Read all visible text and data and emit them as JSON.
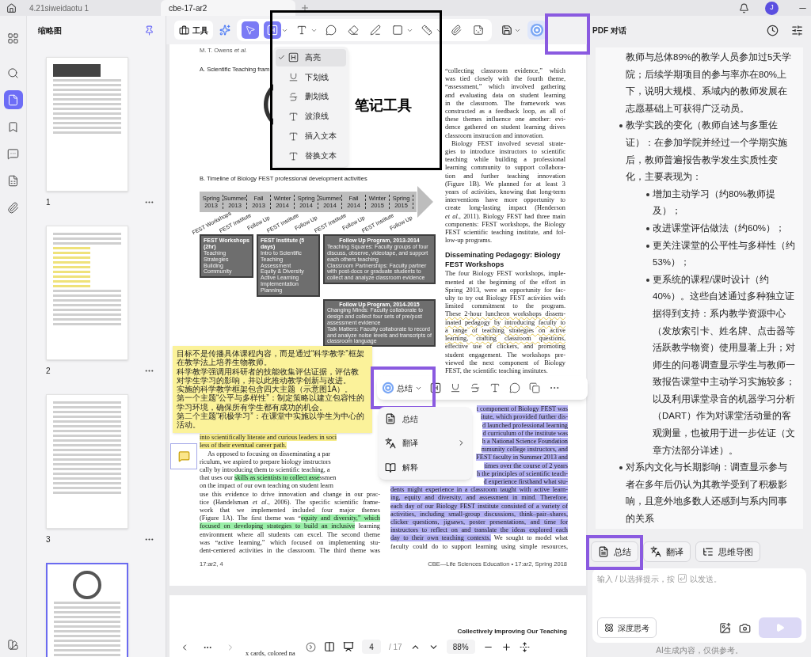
{
  "tabs": [
    {
      "label": "4.21siweidaotu 1",
      "selected": false
    },
    {
      "label": "cbe-17-ar2",
      "selected": true
    }
  ],
  "user": {
    "avatar": "J"
  },
  "rail": [
    {
      "kind": "grid",
      "selected": false
    },
    {
      "kind": "search",
      "selected": false
    },
    {
      "kind": "pages",
      "selected": true
    },
    {
      "kind": "bookmarks",
      "selected": false
    },
    {
      "kind": "comments",
      "selected": false
    },
    {
      "kind": "forms",
      "selected": false
    },
    {
      "kind": "attachments",
      "selected": false
    }
  ],
  "thumbnails": {
    "title": "缩略图",
    "pages": [
      {
        "number": "1",
        "selected": false,
        "kind": "title"
      },
      {
        "number": "2",
        "selected": false,
        "kind": "highlighted"
      },
      {
        "number": "3",
        "selected": false,
        "kind": "text"
      },
      {
        "selected": true,
        "kind": "figure"
      }
    ]
  },
  "toolbar": {
    "tools_label": "工具",
    "tools": [
      {
        "kind": "select",
        "selected": true,
        "menu": false
      },
      {
        "kind": "highlight",
        "selected": true,
        "menu": true
      },
      {
        "kind": "text",
        "selected": false,
        "menu": true
      },
      {
        "kind": "comment",
        "selected": false,
        "menu": false
      },
      {
        "kind": "eraser",
        "selected": false,
        "menu": false
      },
      {
        "kind": "pen",
        "selected": false,
        "menu": false
      },
      {
        "kind": "shape",
        "selected": false,
        "menu": true
      },
      {
        "kind": "ruler",
        "selected": false,
        "menu": true
      },
      {
        "kind": "attachment",
        "selected": false,
        "menu": false
      },
      {
        "kind": "sticker",
        "selected": false,
        "menu": false
      }
    ],
    "ai_selected": true
  },
  "note_tools_menu": [
    {
      "kind": "highlight",
      "label": "高亮",
      "checked": true
    },
    {
      "kind": "underline",
      "label": "下划线",
      "checked": false
    },
    {
      "kind": "strikethrough",
      "label": "删划线",
      "checked": false
    },
    {
      "kind": "squiggly",
      "label": "波浪线",
      "checked": false
    },
    {
      "kind": "insert",
      "label": "插入文本",
      "checked": false
    },
    {
      "kind": "replace",
      "label": "替换文本",
      "checked": false
    }
  ],
  "callout": {
    "label": "笔记工具"
  },
  "document": {
    "header": "M. T. Owens *et al.*",
    "figure_a_caption": "A. Scientific Teaching fram",
    "timeline": {
      "title": "B. Timeline of Biology FEST professional development activities",
      "seasons": [
        "Spring 2013",
        "Summer 2013",
        "Fall 2013",
        "Winter 2014",
        "Spring 2014",
        "Summer 2014",
        "Fall 2014",
        "Winter 2015",
        "Spring 2015"
      ],
      "labels": [
        "FEST Workshops",
        "FEST Institute",
        "Follow Up",
        "FEST Institute",
        "Follow Up",
        "FEST Institute",
        "Follow Up",
        "FEST Institute",
        "Follow Up"
      ]
    },
    "boxes": [
      {
        "title": "FEST Workshops (2hr)",
        "lines": [
          "Teaching Strategies",
          "Building Community"
        ]
      },
      {
        "title": "FEST Institute (5 days)",
        "lines": [
          "Intro to Scientific Teaching",
          "Assessment",
          "Equity & Diversity",
          "Active Learning",
          "Implementation Planning"
        ]
      },
      {
        "title": "Follow Up Program, 2013-2014",
        "lines": [
          "Teaching Squares: Faculty groups of four discuss, observe, videotape, and support each others teaching",
          "Classroom Partnerships: Faculty partner with post-docs or graduate students to collect and analyze classroom evidence"
        ]
      },
      {
        "title": "Follow Up Program, 2014-2015",
        "lines": [
          "Changing Minds: Faculty collaborate to design and collect four sets of pre/post assessment evidence",
          "Talk Matters: Faculty collaborate to record and analyze noise levels and transcripts of classroom language"
        ]
      }
    ],
    "top_right_lines": [
      {
        "text": "“collecting classroom evidence,” which"
      },
      {
        "text": "was tied closely with the fourth theme,"
      },
      {
        "text": "“assessment,” which involved gathering"
      },
      {
        "text": "and evaluating data on student learning"
      },
      {
        "text": "in the classroom. The framework was"
      },
      {
        "text": "constructed as a feedback loop, as all of"
      },
      {
        "text": "these themes influence one another: evi-"
      },
      {
        "text": "dence gathered on student learning drives"
      },
      {
        "text": "classroom instruction and innovation.",
        "kind": "last"
      },
      {
        "text": "Biology FEST involved several strate-",
        "kind": "indent"
      },
      {
        "text": "gies to introduce instructors to scientific"
      },
      {
        "text": "teaching while building a professional"
      },
      {
        "text": "learning community to support collabora-"
      },
      {
        "text": "tion and further teaching innovation"
      },
      {
        "text": "(Figure 1B). We planned for at least 3"
      },
      {
        "text": "years of activities, knowing that long-term"
      },
      {
        "text": "interventions have more opportunity to"
      },
      {
        "text": "create long-lasting impact (Henderson"
      },
      {
        "text": "*et al.*, 2011). Biology FEST had three main"
      },
      {
        "text": "components: FEST workshops, the Biology"
      },
      {
        "text": "FEST scientific teaching institute, and fol-"
      },
      {
        "text": "low-up programs.",
        "kind": "last"
      },
      {
        "text": "Disseminating Pedagogy: Biology FEST Workshops",
        "kind": "heading"
      },
      {
        "text": "The four Biology FEST workshops, imple-"
      },
      {
        "text": "mented at the beginning of the effort in"
      },
      {
        "text": "Spring 2013, were an opportunity for fac-"
      },
      {
        "text": "ulty to try out Biology FEST activities with"
      },
      {
        "text": "limited commitment to the program."
      },
      {
        "text": "These 2-hour luncheon workshops dissem-",
        "kind": "squiggly"
      },
      {
        "text": "inated pedagogy by introducing faculty to",
        "kind": "squiggly"
      },
      {
        "text": "a range of teaching strategies on active",
        "kind": "squiggly"
      },
      {
        "text": "learning, crafting classroom questions,",
        "kind": "squiggly"
      },
      {
        "text": "effective use of clickers, and promoting"
      },
      {
        "text": "student engagement. The workshops pre-"
      },
      {
        "text": "viewed the next component of Biology"
      },
      {
        "text": "FEST, the scientific teaching institutes.",
        "kind": "last"
      }
    ],
    "left_lines": [
      {
        "text": "into scientifically literate and curious leaders in soci",
        "color": "#f6ec8a",
        "kind": "last"
      },
      {
        "text": "less of their eventual career path.",
        "color": "#f6ec8a",
        "kind": "last"
      },
      {
        "text": "As opposed to focusing on disseminating a par",
        "kind": "indent_cut"
      },
      {
        "text": "riculum, we aspired to prepare biology instructors",
        "kind": "last"
      },
      {
        "text": "cally by introducing them to scientific teaching, a",
        "kind": "last"
      },
      {
        "parts": [
          {
            "text": "that uses our "
          },
          {
            "text": "skills as scientists to collect asse",
            "color": "#9af0a8"
          },
          {
            "text": "ssmen"
          }
        ],
        "kind": "last"
      },
      {
        "text": "on the impact of our own teaching on student learn",
        "kind": "last"
      },
      {
        "text": "use this evidence to drive innovation and change in our prac-"
      },
      {
        "text": "tice (Handelsman *et al.*, 2006). The specific scientific frame-"
      },
      {
        "text": "work that we implemented included four major themes"
      },
      {
        "parts": [
          {
            "text": "(Figure 1A). The first theme was “"
          },
          {
            "text": "equity and diversity,” which",
            "color": "#9af0a8"
          }
        ]
      },
      {
        "parts": [
          {
            "text": "focused on developing strategies to build an inclusive",
            "color": "#9af0a8"
          },
          {
            "text": " learning"
          }
        ]
      },
      {
        "text": "environment where all students can excel. The second theme"
      },
      {
        "text": "was “active learning,” which focused on implementing stu-"
      },
      {
        "text": "dent-centered activities in the classroom. The third theme was"
      }
    ],
    "right_lines": [
      {
        "text": "t component of Biology FEST was",
        "color": "#b3b0f3",
        "kind": "cut"
      },
      {
        "text": "itute, which provided further dis-",
        "color": "#b3b0f3",
        "kind": "cut"
      },
      {
        "text": "d launched professional learning",
        "color": "#b3b0f3",
        "kind": "cut"
      },
      {
        "text": "d curriculum of the institute was",
        "color": "#b3b0f3",
        "kind": "cut"
      },
      {
        "text": "h a National Science Foundation",
        "color": "#b3b0f3",
        "kind": "cut"
      },
      {
        "text": "mmunity college instructors, and",
        "color": "#b3b0f3",
        "kind": "cut"
      },
      {
        "text": "FEST faculty in Summer 2013 and",
        "color": "#b3b0f3",
        "kind": "cut"
      },
      {
        "text": "times over the course of 2 years",
        "color": "#b3b0f3",
        "kind": "cut"
      },
      {
        "text": "h the principles of scientific teach-",
        "color": "#b3b0f3",
        "kind": "cut"
      },
      {
        "text": "d experience firsthand what stu-",
        "color": "#b3b0f3",
        "kind": "cut"
      },
      {
        "text": "dents might experience in a classroom taught with active learn-",
        "color": "#b3b0f3"
      },
      {
        "text": "ing, equity and diversity, and assessment in mind. Therefore,",
        "color": "#b3b0f3"
      },
      {
        "text": "each day of our Biology FEST institute consisted of a variety of",
        "color": "#b3b0f3"
      },
      {
        "text": "activities, including small-group discussions, think–pair–shares,",
        "color": "#b3b0f3"
      },
      {
        "text": "clicker questions, jigsaws, poster presentations, and time for",
        "color": "#b3b0f3"
      },
      {
        "text": "instructors to reflect on and translate the ideas explored each",
        "color": "#b3b0f3"
      },
      {
        "parts": [
          {
            "text": "day to their own teaching contexts.",
            "color": "#b3b0f3"
          },
          {
            "text": " We sought to model what"
          }
        ]
      },
      {
        "text": "faculty could do to support learning using simple resources,"
      }
    ],
    "footer_left": "17:ar2, 4",
    "footer_right": "CBE—Life Sciences Education • 17:ar2, Spring 2018"
  },
  "next_page": {
    "header": "Collectively Improving Our Teaching",
    "line": "x cards, colored na"
  },
  "sticky_note": {
    "lines": [
      "目标不是传播具体课程内容，而是通过“科学教学”框架",
      "在教学法上培养生物教师。",
      "科学教学强调用科研者的技能收集评估证据，评估教",
      "对学生学习的影响，并以此推动教学创新与改进。",
      "实施的科学教学框架包含四大主题（示意图1A）。",
      "第一个主题“公平与多样性”：制定策略以建立包容性的",
      "学习环境，确保所有学生都有成功的机会。",
      "第二个主题“积极学习”：在课堂中实施以学生为中心的",
      "活动。"
    ]
  },
  "selection_toolbar": {
    "ai_label": "总结",
    "tools": [
      {
        "kind": "highlight"
      },
      {
        "kind": "underline"
      },
      {
        "kind": "strikethrough"
      },
      {
        "kind": "squiggly"
      },
      {
        "kind": "comment"
      },
      {
        "kind": "copy"
      },
      {
        "kind": "more"
      }
    ]
  },
  "ai_menu": [
    {
      "kind": "summarize",
      "label": "总结",
      "submenu": false
    },
    {
      "kind": "translate",
      "label": "翻译",
      "submenu": true
    },
    {
      "kind": "explain",
      "label": "解释",
      "submenu": false
    }
  ],
  "chat": {
    "title": "PDF 对话",
    "answer": [
      {
        "kind": "para",
        "text": "教师与总体89%的教学人员参加过5天学院；后续学期项目的参与率亦在80%上下，说明大规模、系域内的教师发展在志愿基础上可获得广泛动员。"
      },
      {
        "kind": "bullet",
        "text": "教学实践的变化（教师自述与多重佐证）：在参加学院并经过一个学期实施后，教师普遍报告教学发生实质性变化，主要表现为：",
        "children": [
          {
            "kind": "bullet",
            "text": "增加主动学习（约80%教师提及）；"
          },
          {
            "kind": "bullet",
            "text": "改进课堂评估做法（约60%）；"
          },
          {
            "kind": "bullet",
            "text": "更关注课堂的公平性与多样性（约53%）；"
          },
          {
            "kind": "bullet",
            "text": "更系统的课程/课时设计（约40%）。这些自述通过多种独立证据得到支持：系内教学资源中心（发放索引卡、姓名牌、点击器等活跃教学物资）使用显著上升；对师生的问卷调查显示学生与教师一致报告课堂中主动学习实施较多；以及利用课堂录音的机器学习分析（DART）作为对课堂活动量的客观测量，也被用于进一步佐证（文章方法部分详述）。"
          }
        ]
      },
      {
        "kind": "bullet",
        "text": "对系内文化与长期影响：调查显示参与者在多年后仍认为其教学受到了积极影响，且意外地多数人还感到与系内同事的关系"
      }
    ],
    "actions": [
      {
        "kind": "summarize",
        "label": "总结"
      },
      {
        "kind": "translate",
        "label": "翻译"
      },
      {
        "kind": "mindmap",
        "label": "思维导图"
      }
    ],
    "placeholder_before": "输入 / 以选择提示，按",
    "placeholder_after": "以发送。",
    "deep_think": "深度思考",
    "send_disabled": true,
    "disclaimer": "AI生成内容，仅供参考。"
  },
  "page_nav": {
    "page": "4",
    "total": "/ 17",
    "zoom": "88%"
  }
}
